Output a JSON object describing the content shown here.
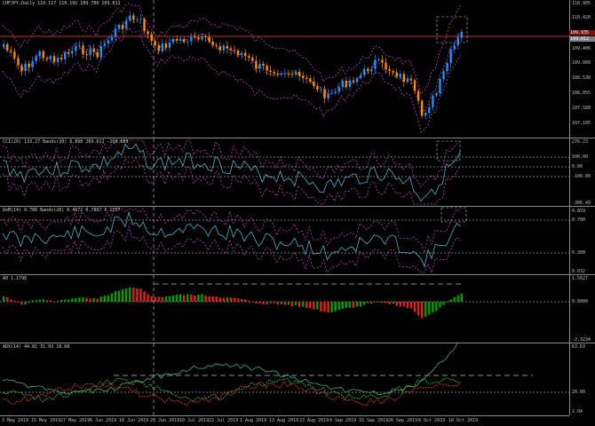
{
  "symbol": "CHFJPY,Daily",
  "ohlc_text": "110.117 110.192 109.700 109.812",
  "indicators": {
    "cci": {
      "label": "CCI(20) 133.27 Bands(20) 8.898 269.617 -268.689"
    },
    "demarker": {
      "label": "DeM(14) 0.786 Bands(20) 0.4672 0.7807 0.1537"
    },
    "ao": {
      "label": "AO 1.1796"
    },
    "adx": {
      "label": "ADX(14) 44.81 31.93 18.68"
    }
  },
  "axes": {
    "price": [
      "110.905",
      "110.420",
      "109.935",
      "109.406",
      "109.000",
      "108.530",
      "108.055",
      "107.580",
      "107.105"
    ],
    "price_tags": {
      "current": "109.812",
      "line": "109.935"
    },
    "cci": [
      "276.23",
      "100.00",
      "0.00",
      "-100.00",
      "-306.49"
    ],
    "demarker": [
      "0.859",
      "0.700",
      "0.300",
      "0.032"
    ],
    "ao": [
      "1.5627",
      "0.0000",
      "-2.3234"
    ],
    "adx": [
      "63.63",
      "20.00",
      "2.04"
    ]
  },
  "dates": [
    "3 May 2019",
    "15 May 2019",
    "27 May 2019",
    "6 Jun 2019",
    "18 Jun 2019",
    "28 Jun 2019",
    "10 Jul 2019",
    "22 Jul 2019",
    "1 Aug 2019",
    "13 Aug 2019",
    "23 Aug 2019",
    "4 Sep 2019",
    "16 Sep 2019",
    "26 Sep 2019",
    "8 Oct 2019",
    "18 Oct 2019"
  ],
  "colors": {
    "bull": "#1e90ff",
    "bear": "#ff8c00",
    "bands": "#c040c0",
    "cci": "#4fb0c6",
    "ao_up": "#00a000",
    "ao_down": "#e02020",
    "adx": "#3cb371",
    "plus_di": "#32cd32",
    "minus_di": "#ff3030",
    "level": "#ff4040"
  }
}
